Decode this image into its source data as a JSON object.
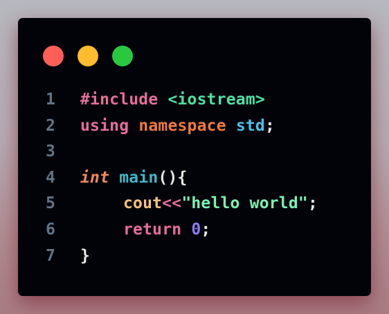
{
  "colors": {
    "background_top": "#b7b8bf",
    "background_bottom": "#a97c84",
    "window": "#020309",
    "line_number": "#627386",
    "light_red": "#ff5f57",
    "light_yellow": "#febc2e",
    "light_green": "#28c840"
  },
  "window_controls": [
    {
      "name": "close",
      "icon": "red-circle-icon"
    },
    {
      "name": "minimize",
      "icon": "yellow-circle-icon"
    },
    {
      "name": "maximize",
      "icon": "green-circle-icon"
    }
  ],
  "code": {
    "language": "cpp",
    "lines": [
      {
        "number": "1",
        "tokens": [
          {
            "text": "#include",
            "color": "#e56f9a"
          },
          {
            "text": " ",
            "color": "#e8e8e8"
          },
          {
            "text": "<iostream>",
            "color": "#4fe0a4"
          }
        ]
      },
      {
        "number": "2",
        "tokens": [
          {
            "text": "using",
            "color": "#e56f9a"
          },
          {
            "text": " ",
            "color": "#e8e8e8"
          },
          {
            "text": "namespace",
            "color": "#ef7a3e"
          },
          {
            "text": " ",
            "color": "#e8e8e8"
          },
          {
            "text": "std",
            "color": "#49c2ec"
          },
          {
            "text": ";",
            "color": "#e8e8e8"
          }
        ]
      },
      {
        "number": "3",
        "tokens": []
      },
      {
        "number": "4",
        "tokens": [
          {
            "text": "int",
            "color": "#ef8a5d",
            "italic": true
          },
          {
            "text": " ",
            "color": "#e8e8e8"
          },
          {
            "text": "main",
            "color": "#3fb8c9"
          },
          {
            "text": "(){",
            "color": "#e8e8e8"
          }
        ]
      },
      {
        "number": "5",
        "indent": true,
        "tokens": [
          {
            "text": "cout",
            "color": "#f9c07d"
          },
          {
            "text": "<<",
            "color": "#e56f9a"
          },
          {
            "text": "\"hello world\"",
            "color": "#7bf3b4"
          },
          {
            "text": ";",
            "color": "#e8e8e8"
          }
        ]
      },
      {
        "number": "6",
        "indent": true,
        "tokens": [
          {
            "text": "return",
            "color": "#e56f9a"
          },
          {
            "text": " ",
            "color": "#e8e8e8"
          },
          {
            "text": "0",
            "color": "#8b7cf6"
          },
          {
            "text": ";",
            "color": "#e8e8e8"
          }
        ]
      },
      {
        "number": "7",
        "tokens": [
          {
            "text": "}",
            "color": "#e8e8e8"
          }
        ]
      }
    ]
  }
}
